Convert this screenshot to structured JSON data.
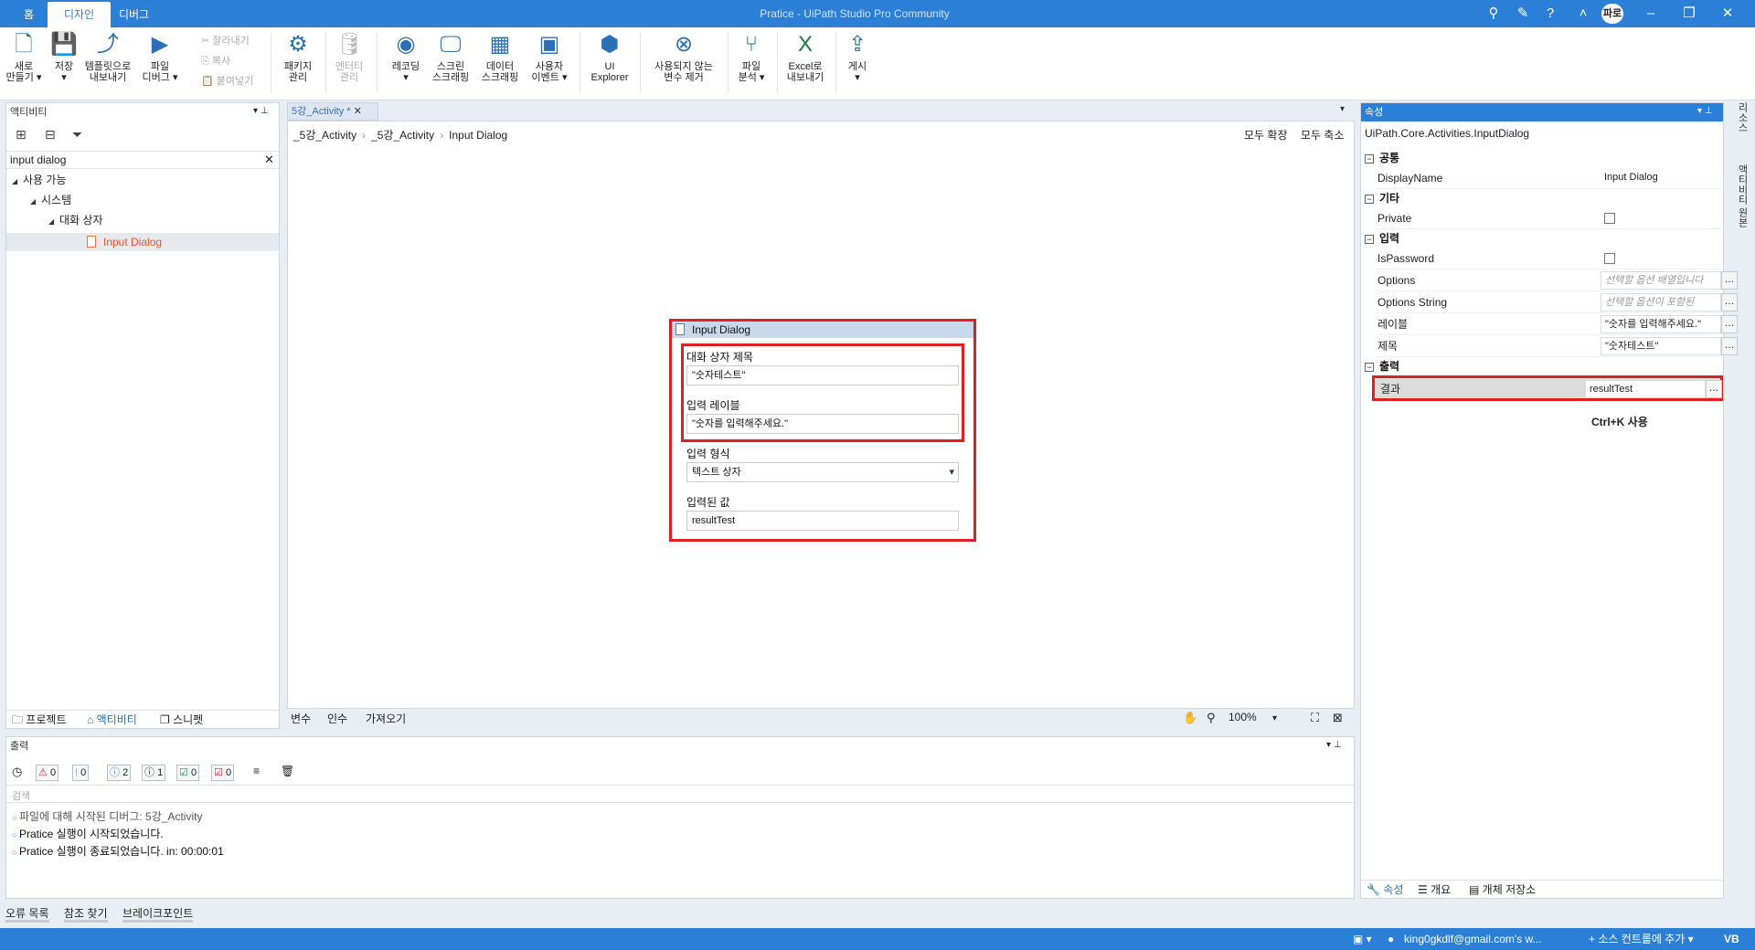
{
  "titlebar": {
    "home_tab": "홈",
    "tabs": [
      "디자인",
      "디버그"
    ],
    "title": "Pratice - UiPath Studio Pro Community",
    "user_initials": "파로"
  },
  "ribbon": {
    "new": "새로\n만들기 ▾",
    "save": "저장\n▾",
    "export_template": "템플릿으로\n내보내기",
    "debug_file": "파일\n디버그 ▾",
    "cut": "잘라내기",
    "copy": "복사",
    "paste": "붙여넣기",
    "manage_packages": "패키지\n관리",
    "manage_entities": "엔터티\n관리",
    "recording": "레코딩\n▾",
    "screen_scraping": "스크린\n스크래핑",
    "data_scraping": "데이터\n스크래핑",
    "user_events": "사용자\n이벤트 ▾",
    "ui_explorer": "UI\nExplorer",
    "remove_unused_vars": "사용되지 않는\n변수 제거",
    "analyze_file": "파일\n분석 ▾",
    "export_excel": "Excel로\n내보내기",
    "publish": "게시\n▾"
  },
  "activities": {
    "header": "액티비티",
    "search_value": "input dialog",
    "tree": [
      "사용 가능",
      "시스템",
      "대화 상자",
      "Input Dialog"
    ],
    "bottom_tabs": [
      "프로젝트",
      "액티비티",
      "스니펫"
    ]
  },
  "designer": {
    "doc_tab": "5강_Activity *",
    "breadcrumb": [
      "_5강_Activity",
      "_5강_Activity",
      "Input Dialog"
    ],
    "expand_all": "모두 확장",
    "collapse_all": "모두 축소",
    "activity": {
      "title": "Input Dialog",
      "dialog_title_label": "대화 상자 제목",
      "dialog_title_value": "\"숫자테스트\"",
      "input_label_label": "입력 레이블",
      "input_label_value": "\"숫자를 입력해주세요.\"",
      "input_type_label": "입력 형식",
      "input_type_value": "텍스트 상자",
      "entered_value_label": "입력된 값",
      "entered_value_value": "resultTest"
    },
    "bottom_tabs": [
      "변수",
      "인수",
      "가져오기"
    ],
    "zoom": "100%"
  },
  "properties": {
    "header": "속성",
    "type_name": "UiPath.Core.Activities.InputDialog",
    "categories": {
      "common": "공통",
      "misc": "기타",
      "input": "입력",
      "output": "출력"
    },
    "rows": {
      "displayname": {
        "name": "DisplayName",
        "value": "Input Dialog"
      },
      "private": {
        "name": "Private"
      },
      "ispassword": {
        "name": "IsPassword"
      },
      "options": {
        "name": "Options",
        "value": "선택할 옵션 배열입니다"
      },
      "options_string": {
        "name": "Options String",
        "value": "선택할 옵션이 포함된"
      },
      "label": {
        "name": "레이블",
        "value": "\"숫자를 입력해주세요.\""
      },
      "title": {
        "name": "제목",
        "value": "\"숫자테스트\""
      },
      "result": {
        "name": "결과",
        "value": "resultTest"
      }
    },
    "note": "Ctrl+K 사용",
    "bottom_tabs": [
      "속성",
      "개요",
      "개체 저장소"
    ],
    "side_tabs": [
      "리소스",
      "액티비티 원본"
    ]
  },
  "output": {
    "header": "출력",
    "counts": {
      "error": "0",
      "warning": "0",
      "info": "2",
      "trace": "1",
      "success": "0",
      "failed": "0"
    },
    "search_placeholder": "검색",
    "lines": [
      "파일에 대해 시작된 디버그: 5강_Activity",
      "Pratice 실행이 시작되었습니다.",
      "Pratice 실행이 종료되었습니다. in: 00:00:01"
    ]
  },
  "bottom_tabs": [
    "오류 목록",
    "참조 찾기",
    "브레이크포인트"
  ],
  "statusbar": {
    "account": "king0gkdlf@gmail.com's w...",
    "source_control": "+ 소스 컨트롤에 추가 ▾",
    "lang": "VB"
  }
}
